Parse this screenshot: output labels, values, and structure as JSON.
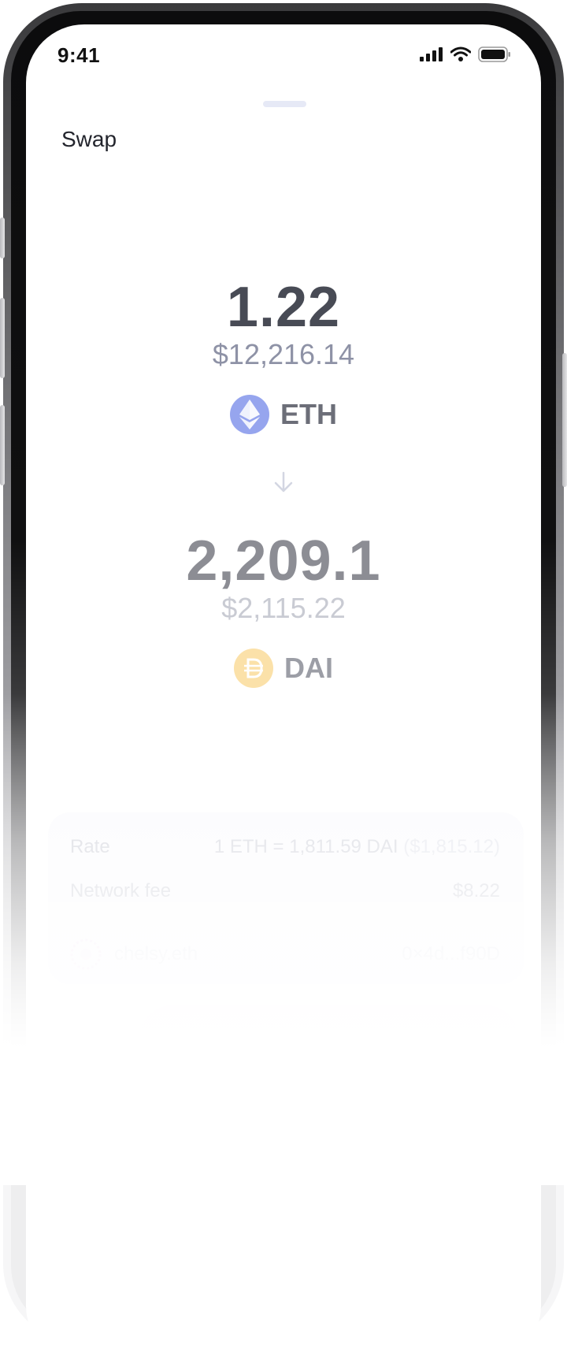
{
  "status_bar": {
    "time": "9:41"
  },
  "header": {
    "title": "Swap"
  },
  "swap": {
    "from": {
      "amount": "1.22",
      "fiat": "$12,216.14",
      "symbol": "ETH",
      "icon": "eth-logo-icon",
      "icon_color": "#96a5ee"
    },
    "to": {
      "amount": "2,209.1",
      "fiat": "$2,115.22",
      "symbol": "DAI",
      "icon": "dai-logo-icon",
      "icon_color": "#fbe1a9"
    }
  },
  "details": {
    "rate_label": "Rate",
    "rate_value": "1 ETH = 1,811.59 DAI",
    "rate_fiat": "($1,815.12)",
    "fee_label": "Network fee",
    "fee_value": "$8.22",
    "account_name": "chelsy.eth",
    "account_address": "0×4d...f90D"
  },
  "colors": {
    "accent_eth": "#96a5ee",
    "accent_dai": "#fbe1a9",
    "button": "#fcf7fd"
  }
}
